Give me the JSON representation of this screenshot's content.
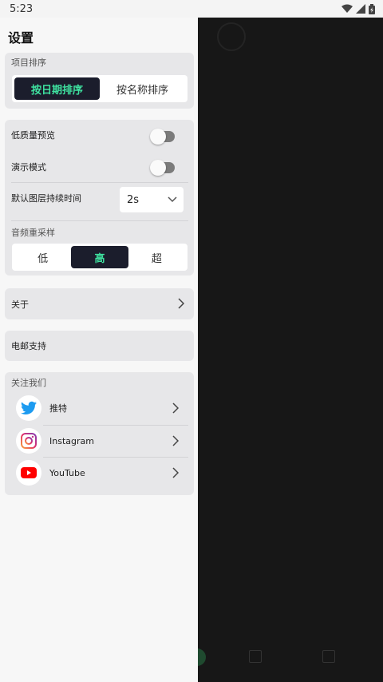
{
  "status": {
    "time": "5:23"
  },
  "drawer": {
    "title": "设置",
    "sort": {
      "label": "项目排序",
      "options": [
        "按日期排序",
        "按名称排序"
      ],
      "selected": "按日期排序"
    },
    "settings": {
      "low_quality_preview": {
        "label": "低质量预览",
        "on": false
      },
      "demo_mode": {
        "label": "演示模式",
        "on": false
      },
      "default_layer_duration": {
        "label": "默认图层持续时间",
        "value": "2s"
      },
      "audio_resample": {
        "label": "音频重采样",
        "options": [
          "低",
          "高",
          "超"
        ],
        "selected": "高"
      }
    },
    "about": {
      "label": "关于"
    },
    "email_support": {
      "label": "电邮支持"
    },
    "follow": {
      "label": "关注我们",
      "items": [
        {
          "label": "推特",
          "icon": "twitter-icon"
        },
        {
          "label": "Instagram",
          "icon": "instagram-icon"
        },
        {
          "label": "YouTube",
          "icon": "youtube-icon"
        }
      ]
    }
  },
  "colors": {
    "accent_green": "#3fe2a0",
    "segment_active_bg": "#1b1d2c",
    "twitter_blue": "#1d9bf0",
    "youtube_red": "#ff0000"
  }
}
